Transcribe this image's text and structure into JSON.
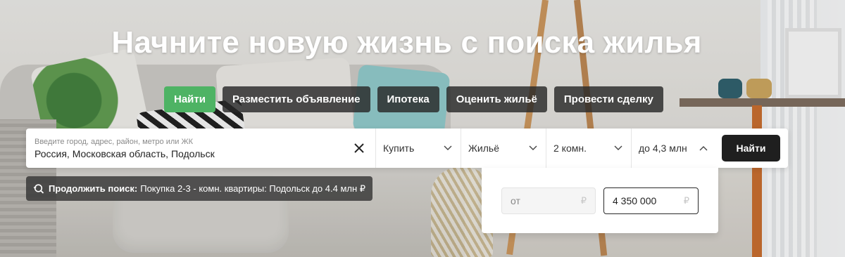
{
  "hero": {
    "title": "Начните новую жизнь с поиска жилья"
  },
  "tabs": [
    {
      "label": "Найти",
      "active": true
    },
    {
      "label": "Разместить объявление",
      "active": false
    },
    {
      "label": "Ипотека",
      "active": false
    },
    {
      "label": "Оценить жильё",
      "active": false
    },
    {
      "label": "Провести сделку",
      "active": false
    }
  ],
  "search": {
    "address_placeholder": "Введите город, адрес, район, метро или ЖК",
    "address_value": "Россия, Московская область, Подольск",
    "deal_type": "Купить",
    "property_type": "Жильё",
    "rooms": "2 комн.",
    "price": "до 4,3 млн",
    "submit_label": "Найти"
  },
  "continue_search": {
    "prefix": "Продолжить поиск:",
    "text": "Покупка 2-3 - комн. квартиры: Подольск до 4.4 млн ₽"
  },
  "price_filter": {
    "from_placeholder": "от",
    "from_currency": "₽",
    "to_value": "4 350 000",
    "to_currency": "₽"
  },
  "colors": {
    "accent_green": "#4eb364",
    "dark_button": "#1f1f1f"
  }
}
